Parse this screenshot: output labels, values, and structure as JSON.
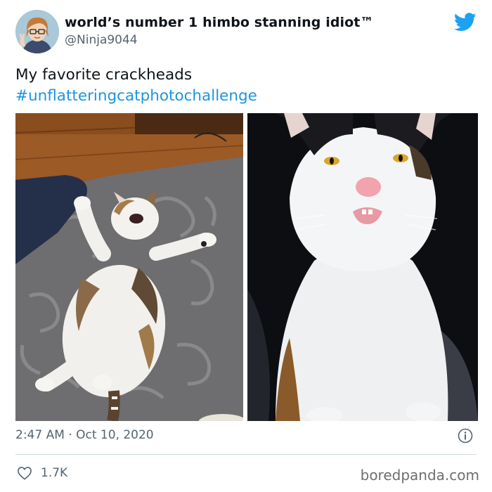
{
  "tweet": {
    "display_name": "world’s number 1 himbo stanning idiot™",
    "handle": "@Ninja9044",
    "text_line": "My favorite crackheads",
    "hashtag": "#unflatteringcatphotochallenge",
    "timestamp": "2:47 AM · Oct 10, 2020",
    "likes": "1.7K"
  },
  "icons": {
    "platform": "twitter-bird-icon",
    "info": "info-icon",
    "like": "heart-icon"
  },
  "colors": {
    "accent": "#1da1f2",
    "hashtag": "#1b95e0",
    "secondary_text": "#536471"
  },
  "watermark": "boredpanda.com"
}
